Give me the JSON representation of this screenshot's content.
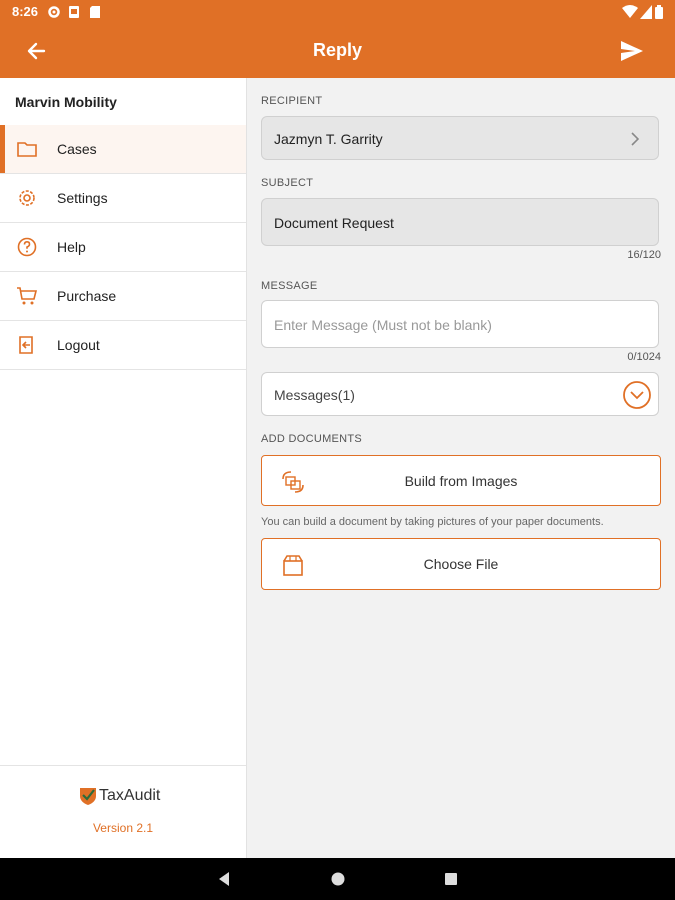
{
  "status": {
    "time": "8:26"
  },
  "appbar": {
    "title": "Reply"
  },
  "sidebar": {
    "user": "Marvin Mobility",
    "items": [
      {
        "label": "Cases",
        "icon": "folder-icon",
        "active": true
      },
      {
        "label": "Settings",
        "icon": "gear-icon",
        "active": false
      },
      {
        "label": "Help",
        "icon": "question-icon",
        "active": false
      },
      {
        "label": "Purchase",
        "icon": "cart-icon",
        "active": false
      },
      {
        "label": "Logout",
        "icon": "logout-icon",
        "active": false
      }
    ],
    "logo": "TaxAudit",
    "version": "Version 2.1"
  },
  "form": {
    "recipient_label": "RECIPIENT",
    "recipient": "Jazmyn T. Garrity",
    "subject_label": "SUBJECT",
    "subject": "Document Request",
    "subject_count": "16/120",
    "message_label": "MESSAGE",
    "message_placeholder": "Enter Message (Must not be blank)",
    "message_count": "0/1024",
    "messages_label": "Messages(1)",
    "add_docs_label": "ADD DOCUMENTS",
    "build_images": "Build from Images",
    "build_hint": "You can build a document by taking pictures of your paper documents.",
    "choose_file": "Choose File"
  },
  "colors": {
    "accent": "#e07026",
    "background": "#f2f2f2"
  }
}
